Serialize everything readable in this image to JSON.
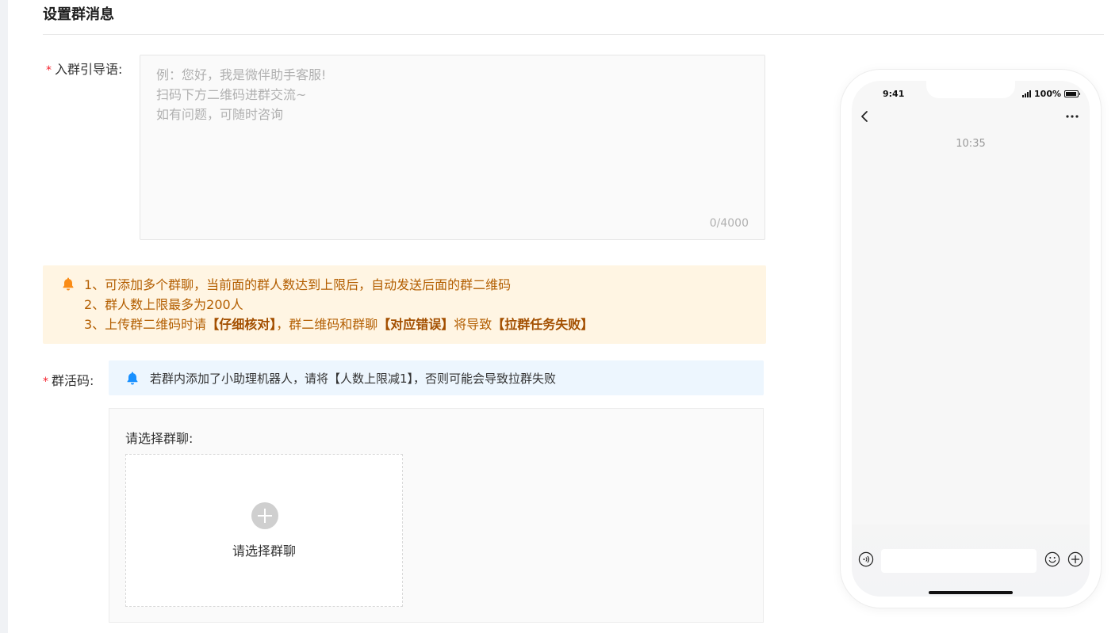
{
  "section": {
    "title": "设置群消息"
  },
  "welcome": {
    "required_mark": "*",
    "label": "入群引导语:",
    "placeholder": "例：您好，我是微伴助手客服!\n扫码下方二维码进群交流~\n如有问题，可随时咨询",
    "value": "",
    "counter": "0/4000"
  },
  "notice": {
    "icon": "bell-icon",
    "color": "#fa8c16",
    "line1": "1、可添加多个群聊，当前面的群人数达到上限后，自动发送后面的群二维码",
    "line2": "2、群人数上限最多为200人",
    "line3_a": "3、上传群二维码时请",
    "line3_b": "【仔细核对】",
    "line3_c": "，群二维码和群聊",
    "line3_d": "【对应错误】",
    "line3_e": "将导致",
    "line3_f": "【拉群任务失败】"
  },
  "group_code": {
    "required_mark": "*",
    "label": "群活码:",
    "info_icon": "bell-icon",
    "info_color": "#1890ff",
    "info_text": "若群内添加了小助理机器人，请将【人数上限减1】，否则可能会导致拉群失败",
    "select_label": "请选择群聊:",
    "picker_label": "请选择群聊",
    "picker_icon": "plus-circle-icon"
  },
  "phone": {
    "status_time": "9:41",
    "battery": "100%",
    "chat_time": "10:35",
    "back_icon": "chevron-left-icon",
    "more_icon": "more-dots-icon",
    "voice_icon": "voice-icon",
    "emoji_icon": "emoji-icon",
    "add_icon": "plus-icon"
  }
}
